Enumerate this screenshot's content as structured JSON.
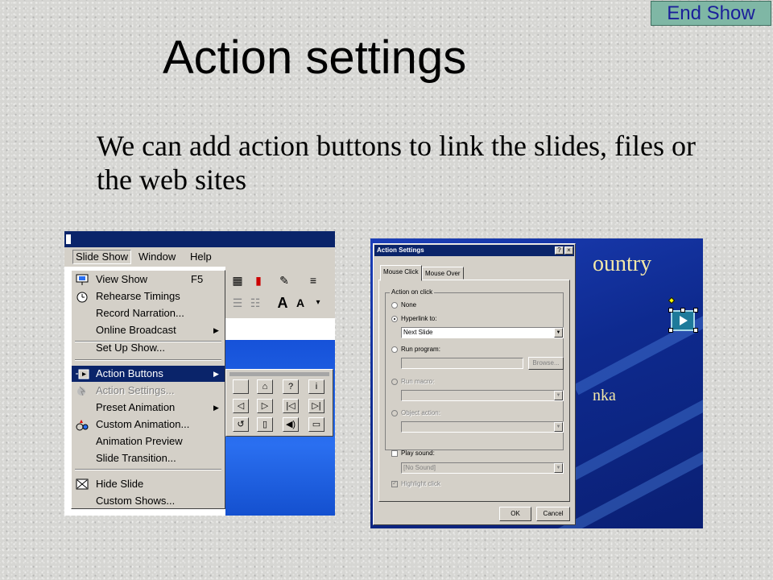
{
  "end_show_label": "End Show",
  "title": "Action settings",
  "body": "We can add action buttons to link the slides, files or the web sites",
  "menu_window": {
    "menubar": [
      "Slide Show",
      "Window",
      "Help"
    ],
    "menu_items": [
      {
        "label": "View Show",
        "shortcut": "F5",
        "icon": "projector-icon"
      },
      {
        "label": "Rehearse Timings",
        "icon": "rehearse-icon"
      },
      {
        "label": "Record Narration..."
      },
      {
        "label": "Online Broadcast",
        "submenu": true
      },
      {
        "label": "Set Up Show..."
      },
      {
        "label": "Action Buttons",
        "submenu": true,
        "highlighted": true,
        "icon": "action-buttons-icon"
      },
      {
        "label": "Action Settings...",
        "disabled": true,
        "icon": "action-settings-icon"
      },
      {
        "label": "Preset Animation",
        "submenu": true
      },
      {
        "label": "Custom Animation...",
        "icon": "custom-animation-icon"
      },
      {
        "label": "Animation Preview"
      },
      {
        "label": "Slide Transition..."
      },
      {
        "label": "Hide Slide",
        "icon": "hide-slide-icon"
      },
      {
        "label": "Custom Shows..."
      }
    ],
    "arrow": "▶",
    "action_button_icons": [
      "custom",
      "home",
      "help",
      "information",
      "back-previous",
      "forward-next",
      "beginning",
      "end",
      "return",
      "document",
      "sound",
      "movie"
    ],
    "action_button_glyphs": [
      "",
      "⌂",
      "?",
      "i",
      "◁",
      "▷",
      "|◁",
      "▷|",
      "↺",
      "▯",
      "◀)",
      "▭"
    ]
  },
  "dialog": {
    "title": "Action Settings",
    "title_buttons": [
      "?",
      "×"
    ],
    "tabs": [
      "Mouse Click",
      "Mouse Over"
    ],
    "active_tab": "Mouse Click",
    "group_label": "Action on click",
    "options": {
      "none": "None",
      "hyperlink": "Hyperlink to:",
      "run_program": "Run program:",
      "run_macro": "Run macro:",
      "object_action": "Object action:"
    },
    "selected_option": "Hyperlink to:",
    "hyperlink_value": "Next Slide",
    "browse_label": "Browse...",
    "play_sound_label": "Play sound:",
    "sound_value": "[No Sound]",
    "highlight_label": "Highlight click",
    "ok_label": "OK",
    "cancel_label": "Cancel",
    "dropdown_glyph": "▼"
  },
  "slide_preview": {
    "text_line1": "ountry",
    "text_line2": "nka"
  }
}
